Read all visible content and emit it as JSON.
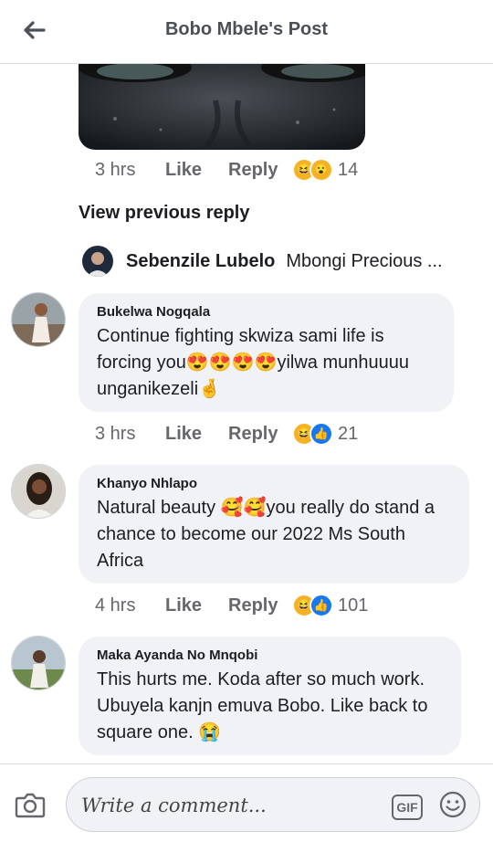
{
  "header": {
    "title": "Bobo Mbele's Post"
  },
  "post_meta": {
    "time": "3 hrs",
    "like": "Like",
    "reply": "Reply",
    "reaction_count": "14"
  },
  "view_previous": "View previous reply",
  "reply_preview": {
    "name": "Sebenzile Lubelo",
    "text": "Mbongi Precious ..."
  },
  "comments": [
    {
      "author": "Bukelwa Nogqala",
      "text": "Continue fighting skwiza sami life is forcing you😍😍😍😍yilwa munhuuuu unganikezeli🤞",
      "time": "3 hrs",
      "like": "Like",
      "reply": "Reply",
      "reaction_count": "21"
    },
    {
      "author": "Khanyo Nhlapo",
      "text": "Natural beauty 🥰🥰you really do stand a chance to become our 2022 Ms South Africa",
      "time": "4 hrs",
      "like": "Like",
      "reply": "Reply",
      "reaction_count": "101"
    },
    {
      "author": "Maka Ayanda No Mnqobi",
      "text": "This hurts me. Koda after so much work. Ubuyela kanjn emuva Bobo. Like back to square one. 😭"
    }
  ],
  "composer": {
    "placeholder": "Write a comment...",
    "gif_label": "GIF"
  },
  "colors": {
    "bubble": "#f0f2f5",
    "meta_text": "#65676b",
    "like_blue": "#1877f2",
    "haha_yellow": "#f7b125"
  }
}
